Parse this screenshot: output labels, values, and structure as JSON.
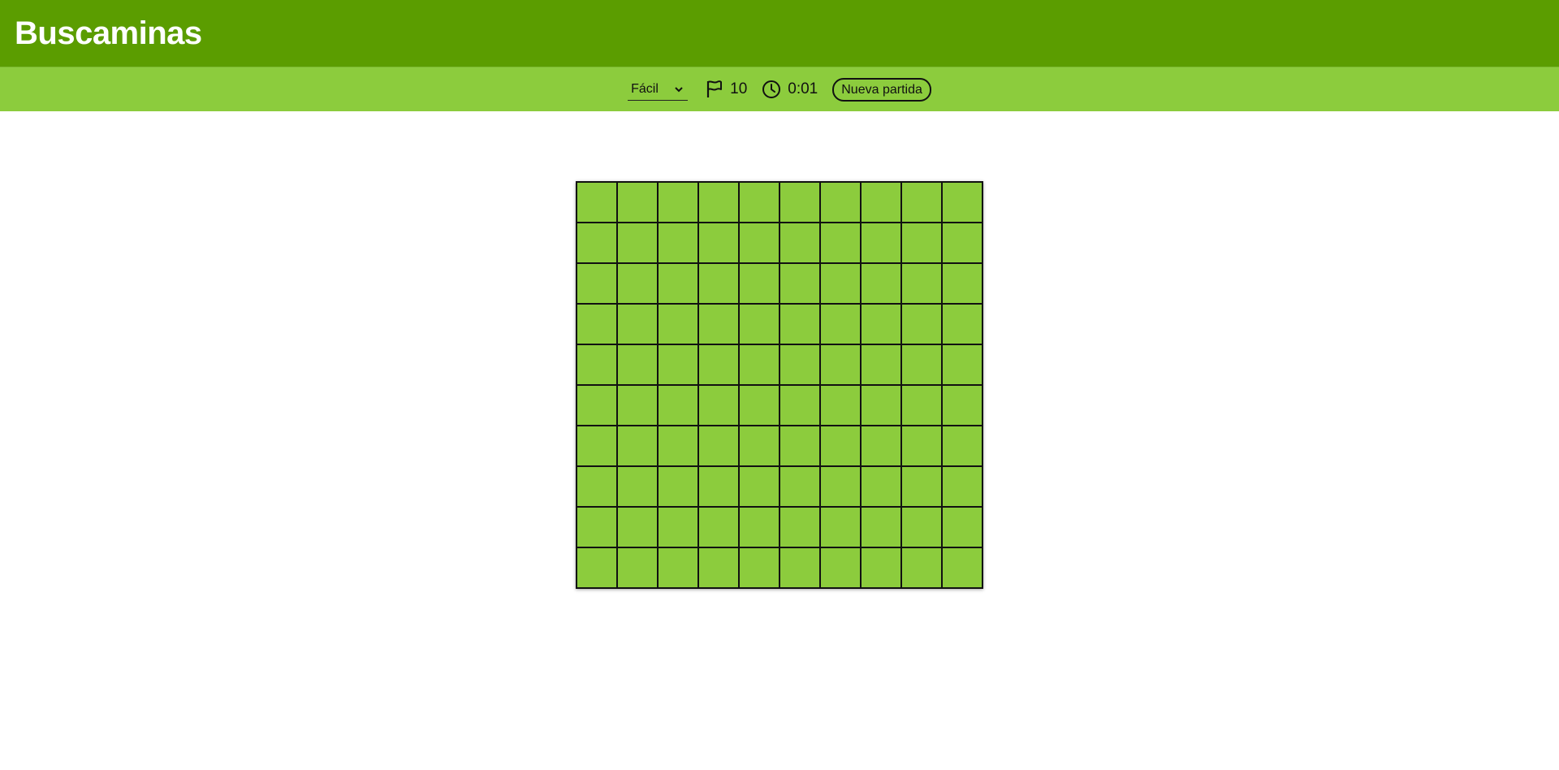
{
  "app": {
    "title": "Buscaminas"
  },
  "toolbar": {
    "difficulty": {
      "selected": "Fácil",
      "icon": "chevron-down-icon"
    },
    "flags": {
      "icon": "flag-icon",
      "count": "10"
    },
    "timer": {
      "icon": "clock-icon",
      "value": "0:01"
    },
    "new_game_label": "Nueva partida"
  },
  "board": {
    "rows": 10,
    "cols": 10,
    "state": "all-covered"
  },
  "colors": {
    "header": "#5b9d00",
    "toolbar": "#8ccc3d",
    "cell": "#8ccc3d",
    "grid_line": "#111111"
  }
}
